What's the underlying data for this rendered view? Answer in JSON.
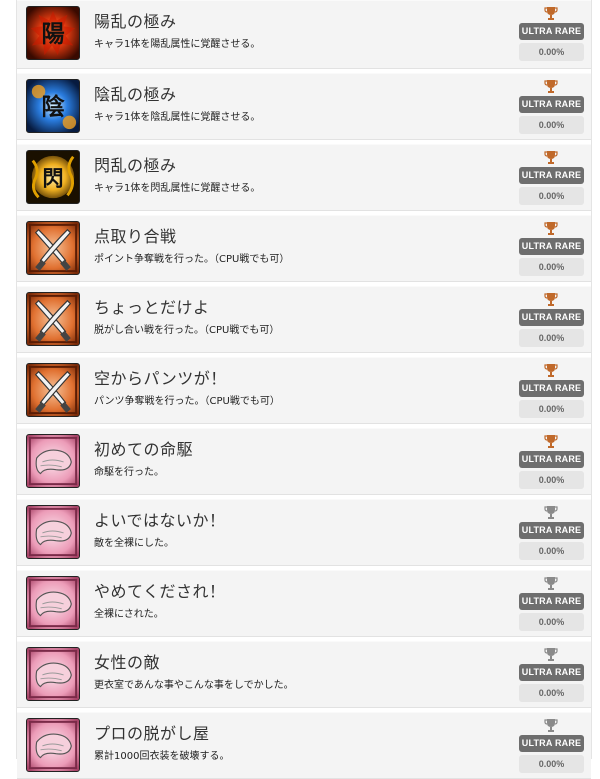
{
  "colors": {
    "trophy_bronze": "#c0692a",
    "trophy_silver": "#8a8a8a",
    "badge_bg": "#6e6e6e",
    "percent_bg": "#e5e5e5"
  },
  "achievements": [
    {
      "title": "陽乱の極み",
      "description": "キャラ1体を陽乱属性に覚醒させる。",
      "rarity": "ULTRA RARE",
      "percent": "0.00%",
      "icon": "yang-kanji-icon",
      "trophy": "bronze-trophy-icon"
    },
    {
      "title": "陰乱の極み",
      "description": "キャラ1体を陰乱属性に覚醒させる。",
      "rarity": "ULTRA RARE",
      "percent": "0.00%",
      "icon": "yin-kanji-icon",
      "trophy": "bronze-trophy-icon"
    },
    {
      "title": "閃乱の極み",
      "description": "キャラ1体を閃乱属性に覚醒させる。",
      "rarity": "ULTRA RARE",
      "percent": "0.00%",
      "icon": "flash-kanji-icon",
      "trophy": "bronze-trophy-icon"
    },
    {
      "title": "点取り合戦",
      "description": "ポイント争奪戦を行った。（CPU戦でも可）",
      "rarity": "ULTRA RARE",
      "percent": "0.00%",
      "icon": "crossed-swords-icon",
      "trophy": "bronze-trophy-icon"
    },
    {
      "title": "ちょっとだけよ",
      "description": "脱がし合い戦を行った。（CPU戦でも可）",
      "rarity": "ULTRA RARE",
      "percent": "0.00%",
      "icon": "crossed-swords-icon",
      "trophy": "bronze-trophy-icon"
    },
    {
      "title": "空からパンツが！",
      "description": "パンツ争奪戦を行った。（CPU戦でも可）",
      "rarity": "ULTRA RARE",
      "percent": "0.00%",
      "icon": "crossed-swords-icon",
      "trophy": "bronze-trophy-icon"
    },
    {
      "title": "初めての命駆",
      "description": "命駆を行った。",
      "rarity": "ULTRA RARE",
      "percent": "0.00%",
      "icon": "pink-cloth-icon",
      "trophy": "bronze-trophy-icon"
    },
    {
      "title": "よいではないか！",
      "description": "敵を全裸にした。",
      "rarity": "ULTRA RARE",
      "percent": "0.00%",
      "icon": "pink-cloth-icon",
      "trophy": "silver-trophy-icon"
    },
    {
      "title": "やめてくだされ！",
      "description": "全裸にされた。",
      "rarity": "ULTRA RARE",
      "percent": "0.00%",
      "icon": "pink-cloth-icon",
      "trophy": "silver-trophy-icon"
    },
    {
      "title": "女性の敵",
      "description": "更衣室であんな事やこんな事をしでかした。",
      "rarity": "ULTRA RARE",
      "percent": "0.00%",
      "icon": "pink-cloth-icon",
      "trophy": "silver-trophy-icon"
    },
    {
      "title": "プロの脱がし屋",
      "description": "累計1000回衣装を破壊する。",
      "rarity": "ULTRA RARE",
      "percent": "0.00%",
      "icon": "pink-cloth-icon",
      "trophy": "silver-trophy-icon"
    }
  ]
}
